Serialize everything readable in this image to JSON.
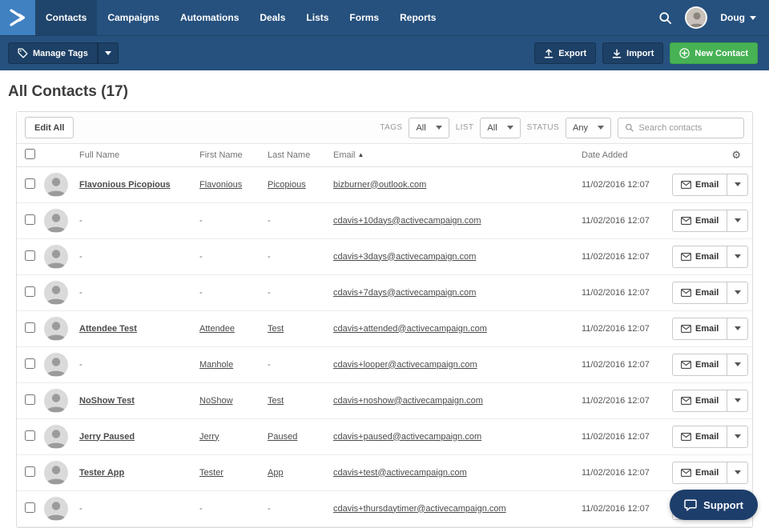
{
  "navbar": {
    "items": [
      {
        "label": "Contacts",
        "active": true
      },
      {
        "label": "Campaigns",
        "active": false
      },
      {
        "label": "Automations",
        "active": false
      },
      {
        "label": "Deals",
        "active": false
      },
      {
        "label": "Lists",
        "active": false
      },
      {
        "label": "Forms",
        "active": false
      },
      {
        "label": "Reports",
        "active": false
      }
    ],
    "user": {
      "name": "Doug"
    }
  },
  "actionbar": {
    "manage_tags": "Manage Tags",
    "export": "Export",
    "import": "Import",
    "new_contact": "New Contact"
  },
  "page": {
    "title": "All Contacts (17)"
  },
  "toolbar": {
    "edit_all": "Edit All",
    "filters": [
      {
        "label": "TAGS",
        "value": "All"
      },
      {
        "label": "LIST",
        "value": "All"
      },
      {
        "label": "STATUS",
        "value": "Any"
      }
    ],
    "search_placeholder": "Search contacts"
  },
  "table": {
    "headers": {
      "full_name": "Full Name",
      "first_name": "First Name",
      "last_name": "Last Name",
      "email": "Email",
      "date_added": "Date Added"
    },
    "email_button": "Email",
    "rows": [
      {
        "full_name": "Flavonious Picopious",
        "first_name": "Flavonious",
        "last_name": "Picopious",
        "email": "bizburner@outlook.com",
        "date_added": "11/02/2016 12:07"
      },
      {
        "full_name": "-",
        "first_name": "-",
        "last_name": "-",
        "email": "cdavis+10days@activecampaign.com",
        "date_added": "11/02/2016 12:07"
      },
      {
        "full_name": "-",
        "first_name": "-",
        "last_name": "-",
        "email": "cdavis+3days@activecampaign.com",
        "date_added": "11/02/2016 12:07"
      },
      {
        "full_name": "-",
        "first_name": "-",
        "last_name": "-",
        "email": "cdavis+7days@activecampaign.com",
        "date_added": "11/02/2016 12:07"
      },
      {
        "full_name": "Attendee Test",
        "first_name": "Attendee",
        "last_name": "Test",
        "email": "cdavis+attended@activecampaign.com",
        "date_added": "11/02/2016 12:07"
      },
      {
        "full_name": "-",
        "first_name": "Manhole",
        "last_name": "-",
        "email": "cdavis+looper@activecampaign.com",
        "date_added": "11/02/2016 12:07"
      },
      {
        "full_name": "NoShow Test",
        "first_name": "NoShow",
        "last_name": "Test",
        "email": "cdavis+noshow@activecampaign.com",
        "date_added": "11/02/2016 12:07"
      },
      {
        "full_name": "Jerry Paused",
        "first_name": "Jerry",
        "last_name": "Paused",
        "email": "cdavis+paused@activecampaign.com",
        "date_added": "11/02/2016 12:07"
      },
      {
        "full_name": "Tester App",
        "first_name": "Tester",
        "last_name": "App",
        "email": "cdavis+test@activecampaign.com",
        "date_added": "11/02/2016 12:07"
      },
      {
        "full_name": "-",
        "first_name": "-",
        "last_name": "-",
        "email": "cdavis+thursdaytimer@activecampaign.com",
        "date_added": "11/02/2016 12:07"
      }
    ]
  },
  "support": {
    "label": "Support"
  },
  "icons": {
    "gear": "⚙",
    "sort_asc": "▲"
  },
  "colors": {
    "navbar_bg": "#26517e",
    "logo_bg": "#3f81c1",
    "dark_button_bg": "#1d4066",
    "new_contact_green": "#47b254",
    "support_bg": "#1d3e6b"
  }
}
